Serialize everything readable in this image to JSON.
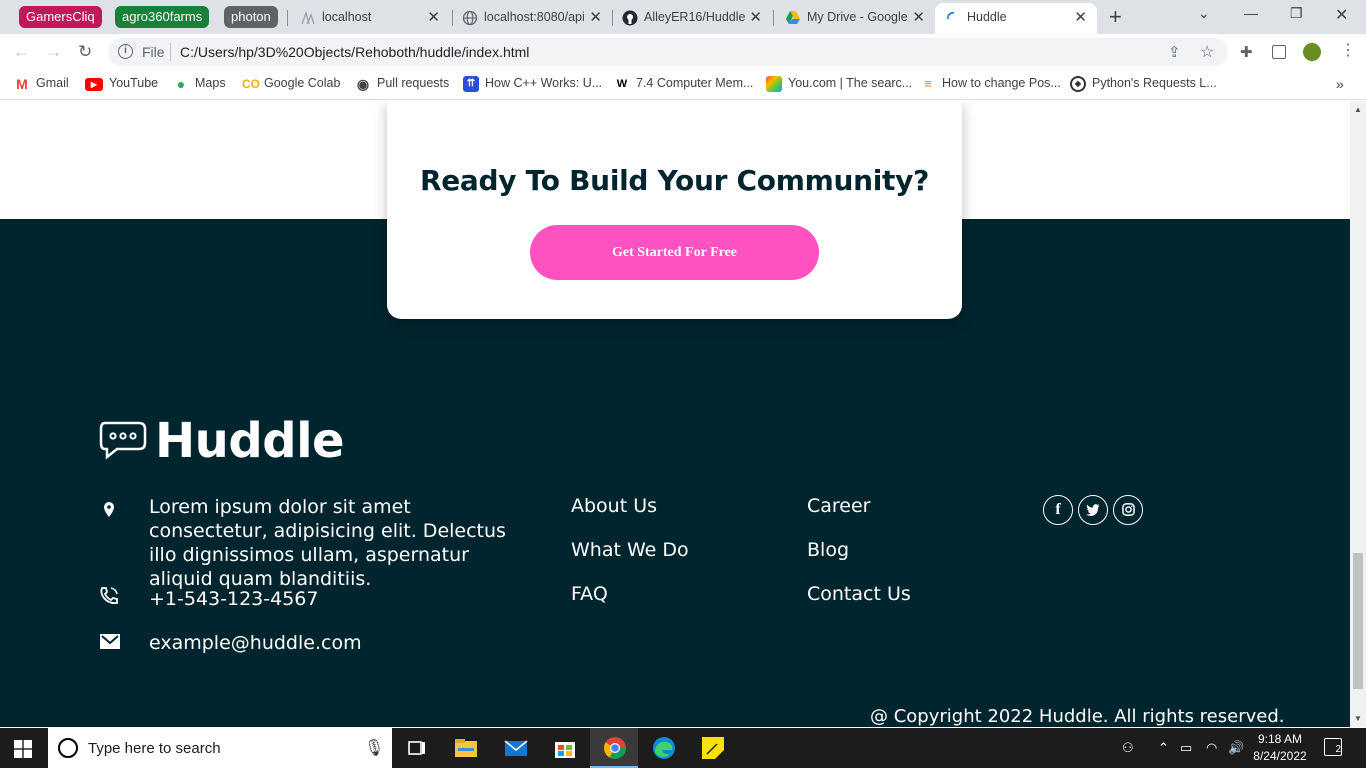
{
  "browser": {
    "tab_groups": [
      {
        "label": "GamersCliq",
        "color": "#c2185b"
      },
      {
        "label": "agro360farms",
        "color": "#188038"
      },
      {
        "label": "photon",
        "color": "#5f6368"
      }
    ],
    "tabs": [
      {
        "title": "localhost",
        "icon": "localhost-favicon"
      },
      {
        "title": "localhost:8080/api",
        "icon": "globe-icon"
      },
      {
        "title": "AlleyER16/Huddle",
        "icon": "github-icon"
      },
      {
        "title": "My Drive - Google",
        "icon": "google-drive-icon"
      },
      {
        "title": "Huddle",
        "icon": "loading-icon",
        "active": true
      }
    ],
    "address": {
      "scheme_label": "File",
      "url": "C:/Users/hp/3D%20Objects/Rehoboth/huddle/index.html"
    },
    "bookmarks": [
      {
        "label": "Gmail",
        "icon": "gmail-icon"
      },
      {
        "label": "YouTube",
        "icon": "youtube-icon"
      },
      {
        "label": "Maps",
        "icon": "maps-icon"
      },
      {
        "label": "Google Colab",
        "icon": "colab-icon"
      },
      {
        "label": "Pull requests",
        "icon": "github-icon"
      },
      {
        "label": "How C++ Works: U...",
        "icon": "bookmark-icon"
      },
      {
        "label": "7.4 Computer Mem...",
        "icon": "bookmark-icon"
      },
      {
        "label": "You.com | The searc...",
        "icon": "youcom-icon"
      },
      {
        "label": "How to change Pos...",
        "icon": "stackoverflow-icon"
      },
      {
        "label": "Python's Requests L...",
        "icon": "python-icon"
      }
    ]
  },
  "page": {
    "cta": {
      "title": "Ready To Build Your Community?",
      "button": "Get Started For Free"
    },
    "footer": {
      "brand": "Huddle",
      "address": "Lorem ipsum dolor sit amet consectetur, adipisicing elit. Delectus illo dignissimos ullam, aspernatur aliquid quam blanditiis.",
      "phone": "+1-543-123-4567",
      "email": "example@huddle.com",
      "links_col1": [
        "About Us",
        "What We Do",
        "FAQ"
      ],
      "links_col2": [
        "Career",
        "Blog",
        "Contact Us"
      ],
      "social": [
        "facebook-icon",
        "twitter-icon",
        "instagram-icon"
      ],
      "copyright": "@ Copyright 2022 Huddle. All rights reserved."
    },
    "colors": {
      "footer_bg": "#00252e",
      "accent": "#ff52c1"
    }
  },
  "taskbar": {
    "search_placeholder": "Type here to search",
    "time": "9:18 AM",
    "date": "8/24/2022",
    "notification_count": "2"
  }
}
